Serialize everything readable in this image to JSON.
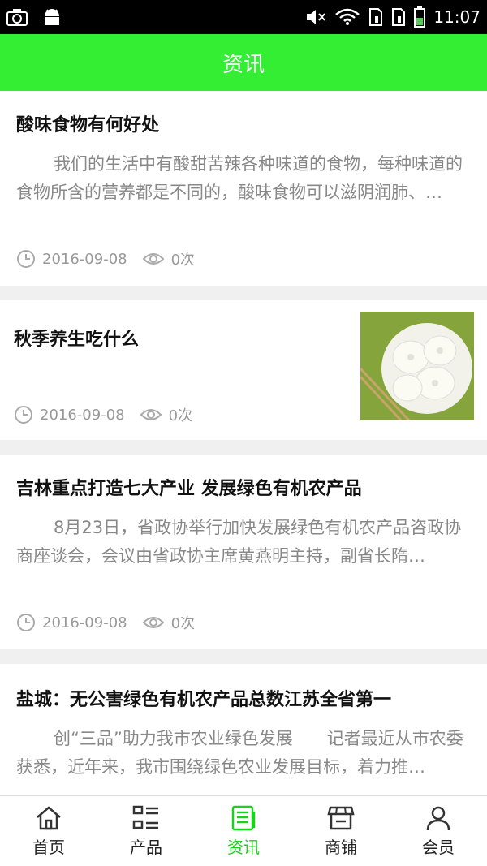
{
  "status_bar": {
    "time": "11:07"
  },
  "header": {
    "title": "资讯"
  },
  "articles": [
    {
      "title": "酸味食物有何好处",
      "summary": "我们的生活中有酸甜苦辣各种味道的食物，每种味道的食物所含的营养都是不同的，酸味食物可以滋阴润肺、…",
      "date": "2016-09-08",
      "views": "0次"
    },
    {
      "title": "秋季养生吃什么",
      "summary": "",
      "date": "2016-09-08",
      "views": "0次"
    },
    {
      "title": "吉林重点打造七大产业 发展绿色有机农产品",
      "summary": "8月23日，省政协举行加快发展绿色有机农产品咨政协商座谈会，会议由省政协主席黄燕明主持，副省长隋…",
      "date": "2016-09-08",
      "views": "0次"
    },
    {
      "title": "盐城：无公害绿色有机农产品总数江苏全省第一",
      "summary": "创“三品”助力我市农业绿色发展　　记者最近从市农委获悉，近年来，我市围绕绿色农业发展目标，着力推…",
      "date": "",
      "views": ""
    }
  ],
  "tabs": [
    {
      "label": "首页",
      "icon": "home-icon"
    },
    {
      "label": "产品",
      "icon": "list-icon"
    },
    {
      "label": "资讯",
      "icon": "news-icon",
      "active": true
    },
    {
      "label": "商铺",
      "icon": "shop-icon"
    },
    {
      "label": "会员",
      "icon": "user-icon"
    }
  ],
  "colors": {
    "accent": "#33ee33",
    "active_tab": "#19d219"
  }
}
